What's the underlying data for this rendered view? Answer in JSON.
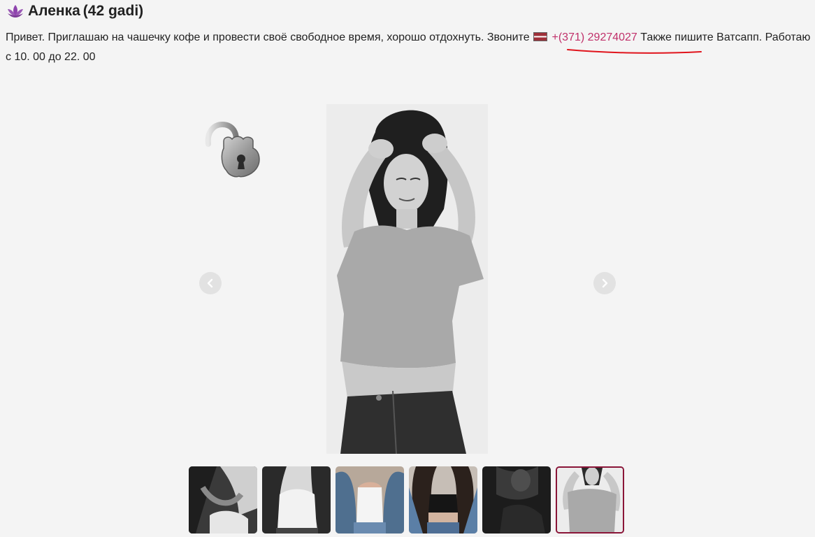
{
  "profile": {
    "name": "Аленка",
    "age_text": "(42 gadi)",
    "description_before_phone": "Привет. Приглашаю на чашечку кофе и провести своё свободное время, хорошо отдохнуть. Звоните",
    "phone": "+(371) 29274027",
    "description_after_phone": "Также пишите Ватсапп. Работаю с 10. 00 до 22. 00",
    "flag_icon": "latvia-flag-icon",
    "title_icon": "lotus-icon"
  },
  "gallery": {
    "lock_icon": "unlocked-padlock-icon",
    "prev_icon": "chevron-left-icon",
    "next_icon": "chevron-right-icon",
    "thumbnails": [
      {
        "name": "photo-1",
        "active": false
      },
      {
        "name": "photo-2",
        "active": false
      },
      {
        "name": "photo-3",
        "active": false
      },
      {
        "name": "photo-4",
        "active": false
      },
      {
        "name": "photo-5",
        "active": false
      },
      {
        "name": "photo-6",
        "active": true
      }
    ]
  },
  "colors": {
    "accent": "#c0306a",
    "title_icon": "#8e44ad",
    "active_thumb_border": "#8a1538",
    "annotation_underline": "#e0141c"
  }
}
